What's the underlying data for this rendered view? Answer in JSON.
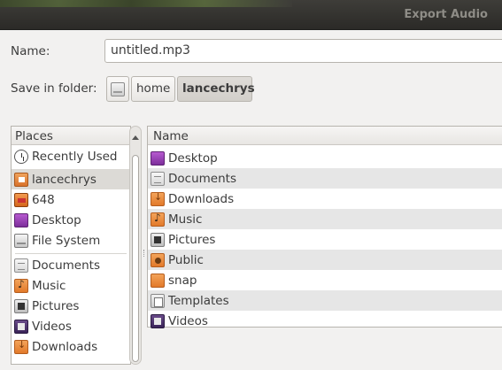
{
  "window": {
    "title": "Export Audio"
  },
  "name_field": {
    "label": "Name:",
    "value": "untitled.mp3"
  },
  "folder": {
    "label": "Save in folder:",
    "path": [
      "home",
      "lancechrys"
    ]
  },
  "places": {
    "header": "Places",
    "items": [
      {
        "label": "Recently Used",
        "icon": "recent-icon"
      },
      {
        "label": "lancechrys",
        "icon": "home-folder-icon",
        "selected": true
      },
      {
        "label": "648",
        "icon": "drive-icon"
      },
      {
        "label": "Desktop",
        "icon": "desktop-folder-icon"
      },
      {
        "label": "File System",
        "icon": "filesystem-icon"
      }
    ],
    "bookmarks": [
      {
        "label": "Documents",
        "icon": "documents-folder-icon"
      },
      {
        "label": "Music",
        "icon": "music-folder-icon"
      },
      {
        "label": "Pictures",
        "icon": "pictures-folder-icon"
      },
      {
        "label": "Videos",
        "icon": "videos-folder-icon"
      },
      {
        "label": "Downloads",
        "icon": "downloads-folder-icon"
      }
    ]
  },
  "files": {
    "header": "Name",
    "items": [
      {
        "label": "Desktop",
        "icon": "desktop-folder-icon"
      },
      {
        "label": "Documents",
        "icon": "documents-folder-icon"
      },
      {
        "label": "Downloads",
        "icon": "downloads-folder-icon"
      },
      {
        "label": "Music",
        "icon": "music-folder-icon"
      },
      {
        "label": "Pictures",
        "icon": "pictures-folder-icon"
      },
      {
        "label": "Public",
        "icon": "public-folder-icon"
      },
      {
        "label": "snap",
        "icon": "folder-icon"
      },
      {
        "label": "Templates",
        "icon": "templates-folder-icon"
      },
      {
        "label": "Videos",
        "icon": "videos-folder-icon"
      }
    ]
  }
}
